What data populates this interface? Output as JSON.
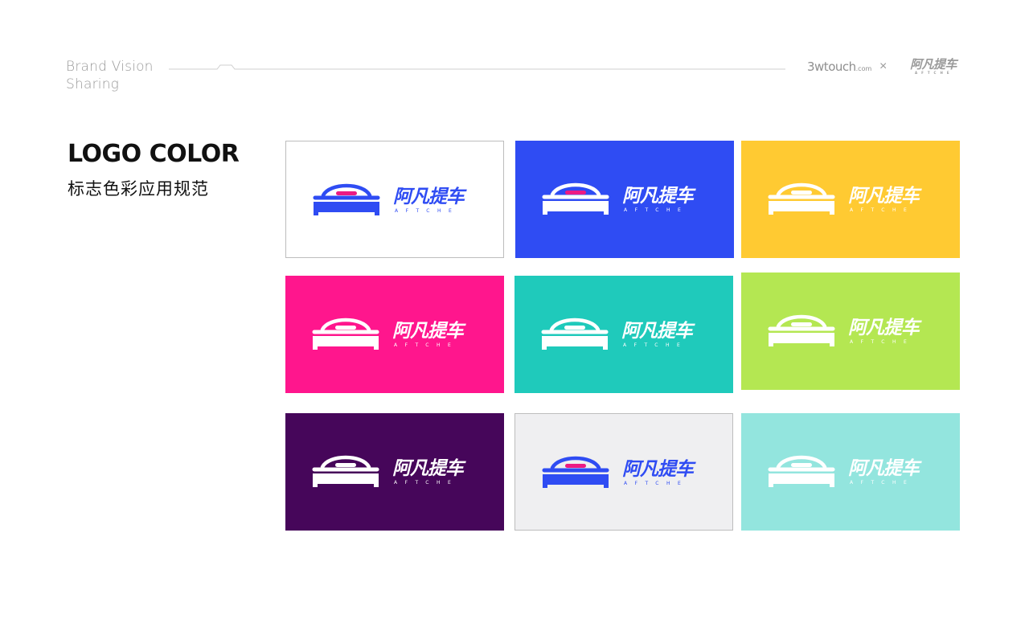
{
  "header": {
    "tagline_line1": "Brand Vision",
    "tagline_line2": "Sharing",
    "partner_name": "3wtouch",
    "partner_suffix": ".com",
    "times_sign": "×",
    "brand_cn": "阿凡提车",
    "brand_en": "AFTCHE"
  },
  "section": {
    "title": "LOGO COLOR",
    "subtitle": "标志色彩应用规范"
  },
  "logo": {
    "name_cn": "阿凡提车",
    "name_en": "AFTCHE",
    "icon": "car-icon"
  },
  "colors": {
    "text_gray": "#9a9a9a",
    "brand_blue": "#2f4cf3",
    "brand_pink": "#ec1b84"
  },
  "cards": [
    {
      "background": "#ffffff",
      "logo_color": "#2f4cf3",
      "accent": "#ec1b84",
      "bordered": true
    },
    {
      "background": "#2f4cf3",
      "logo_color": "#ffffff",
      "accent": "#ec1b84",
      "bordered": false
    },
    {
      "background": "#ffca32",
      "logo_color": "#ffffff",
      "accent": null,
      "bordered": false
    },
    {
      "background": "#ff168d",
      "logo_color": "#ffffff",
      "accent": null,
      "bordered": false
    },
    {
      "background": "#1fcabb",
      "logo_color": "#ffffff",
      "accent": null,
      "bordered": false
    },
    {
      "background": "#b4e752",
      "logo_color": "#ffffff",
      "accent": null,
      "bordered": false
    },
    {
      "background": "#46065a",
      "logo_color": "#ffffff",
      "accent": null,
      "bordered": false
    },
    {
      "background": "#efeff1",
      "logo_color": "#2f4cf3",
      "accent": "#ec1b84",
      "bordered": true
    },
    {
      "background": "#93e5de",
      "logo_color": "#ffffff",
      "accent": null,
      "bordered": false
    }
  ]
}
